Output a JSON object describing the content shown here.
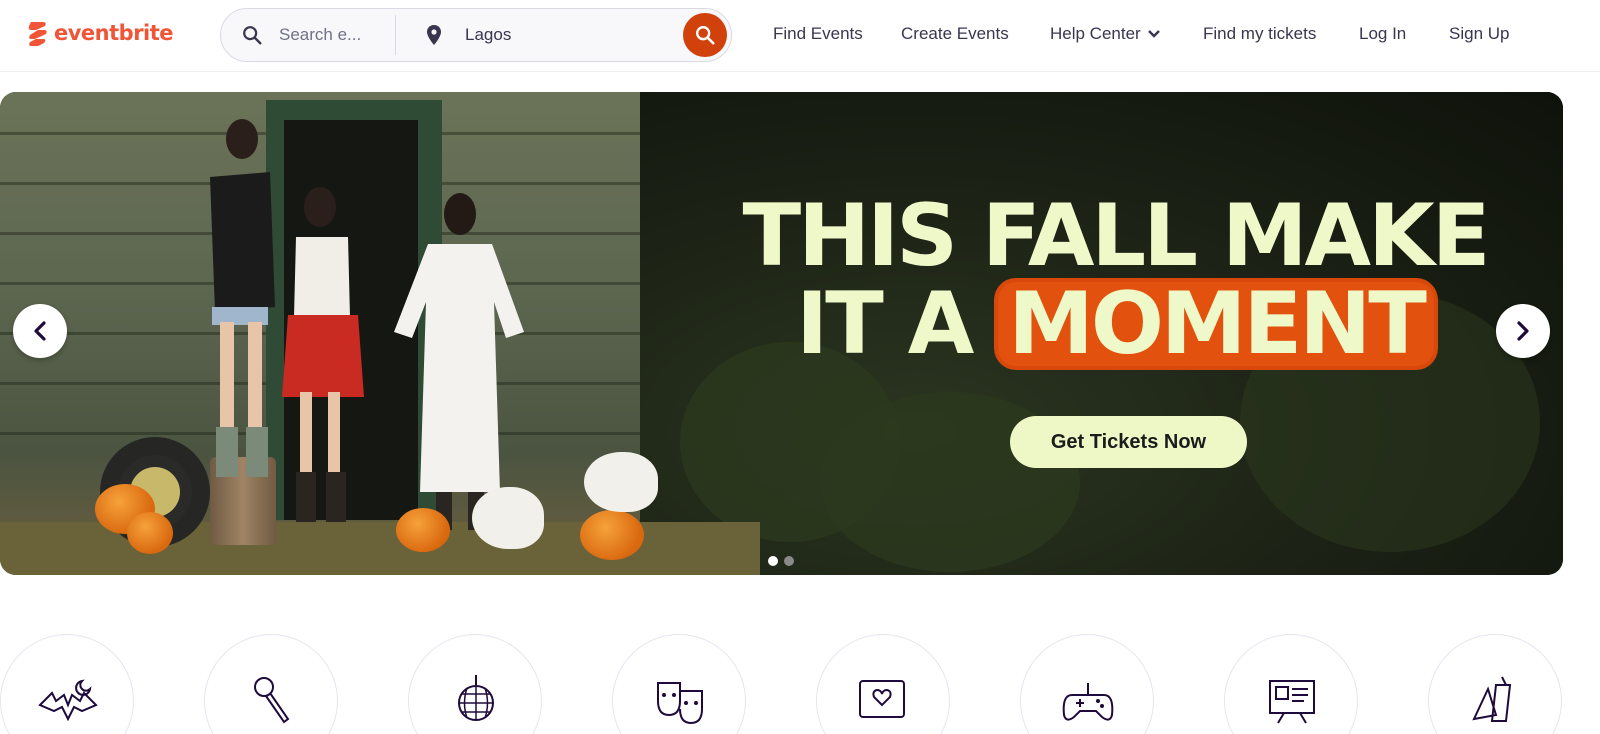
{
  "header": {
    "brand": "eventbrite",
    "search": {
      "placeholder": "Search e...",
      "location": "Lagos"
    },
    "nav": {
      "find_events": "Find Events",
      "create_events": "Create Events",
      "help_center": "Help Center",
      "find_tickets": "Find my tickets",
      "log_in": "Log In",
      "sign_up": "Sign Up"
    }
  },
  "hero": {
    "headline_line1": "THIS FALL MAKE",
    "headline_line2_prefix": "IT A",
    "headline_highlight": "MOMENT",
    "cta": "Get Tickets Now",
    "slides": {
      "count": 2,
      "active": 1
    }
  },
  "categories": [
    {
      "icon": "halloween-icon"
    },
    {
      "icon": "microphone-icon"
    },
    {
      "icon": "disco-ball-icon"
    },
    {
      "icon": "theater-masks-icon"
    },
    {
      "icon": "dating-chat-icon"
    },
    {
      "icon": "gamepad-icon"
    },
    {
      "icon": "presentation-board-icon"
    },
    {
      "icon": "food-drink-icon"
    }
  ],
  "colors": {
    "brand": "#f05537",
    "search_button": "#d1410c",
    "headline": "#eff8c8",
    "highlight": "#e2520e",
    "text": "#39364f"
  }
}
